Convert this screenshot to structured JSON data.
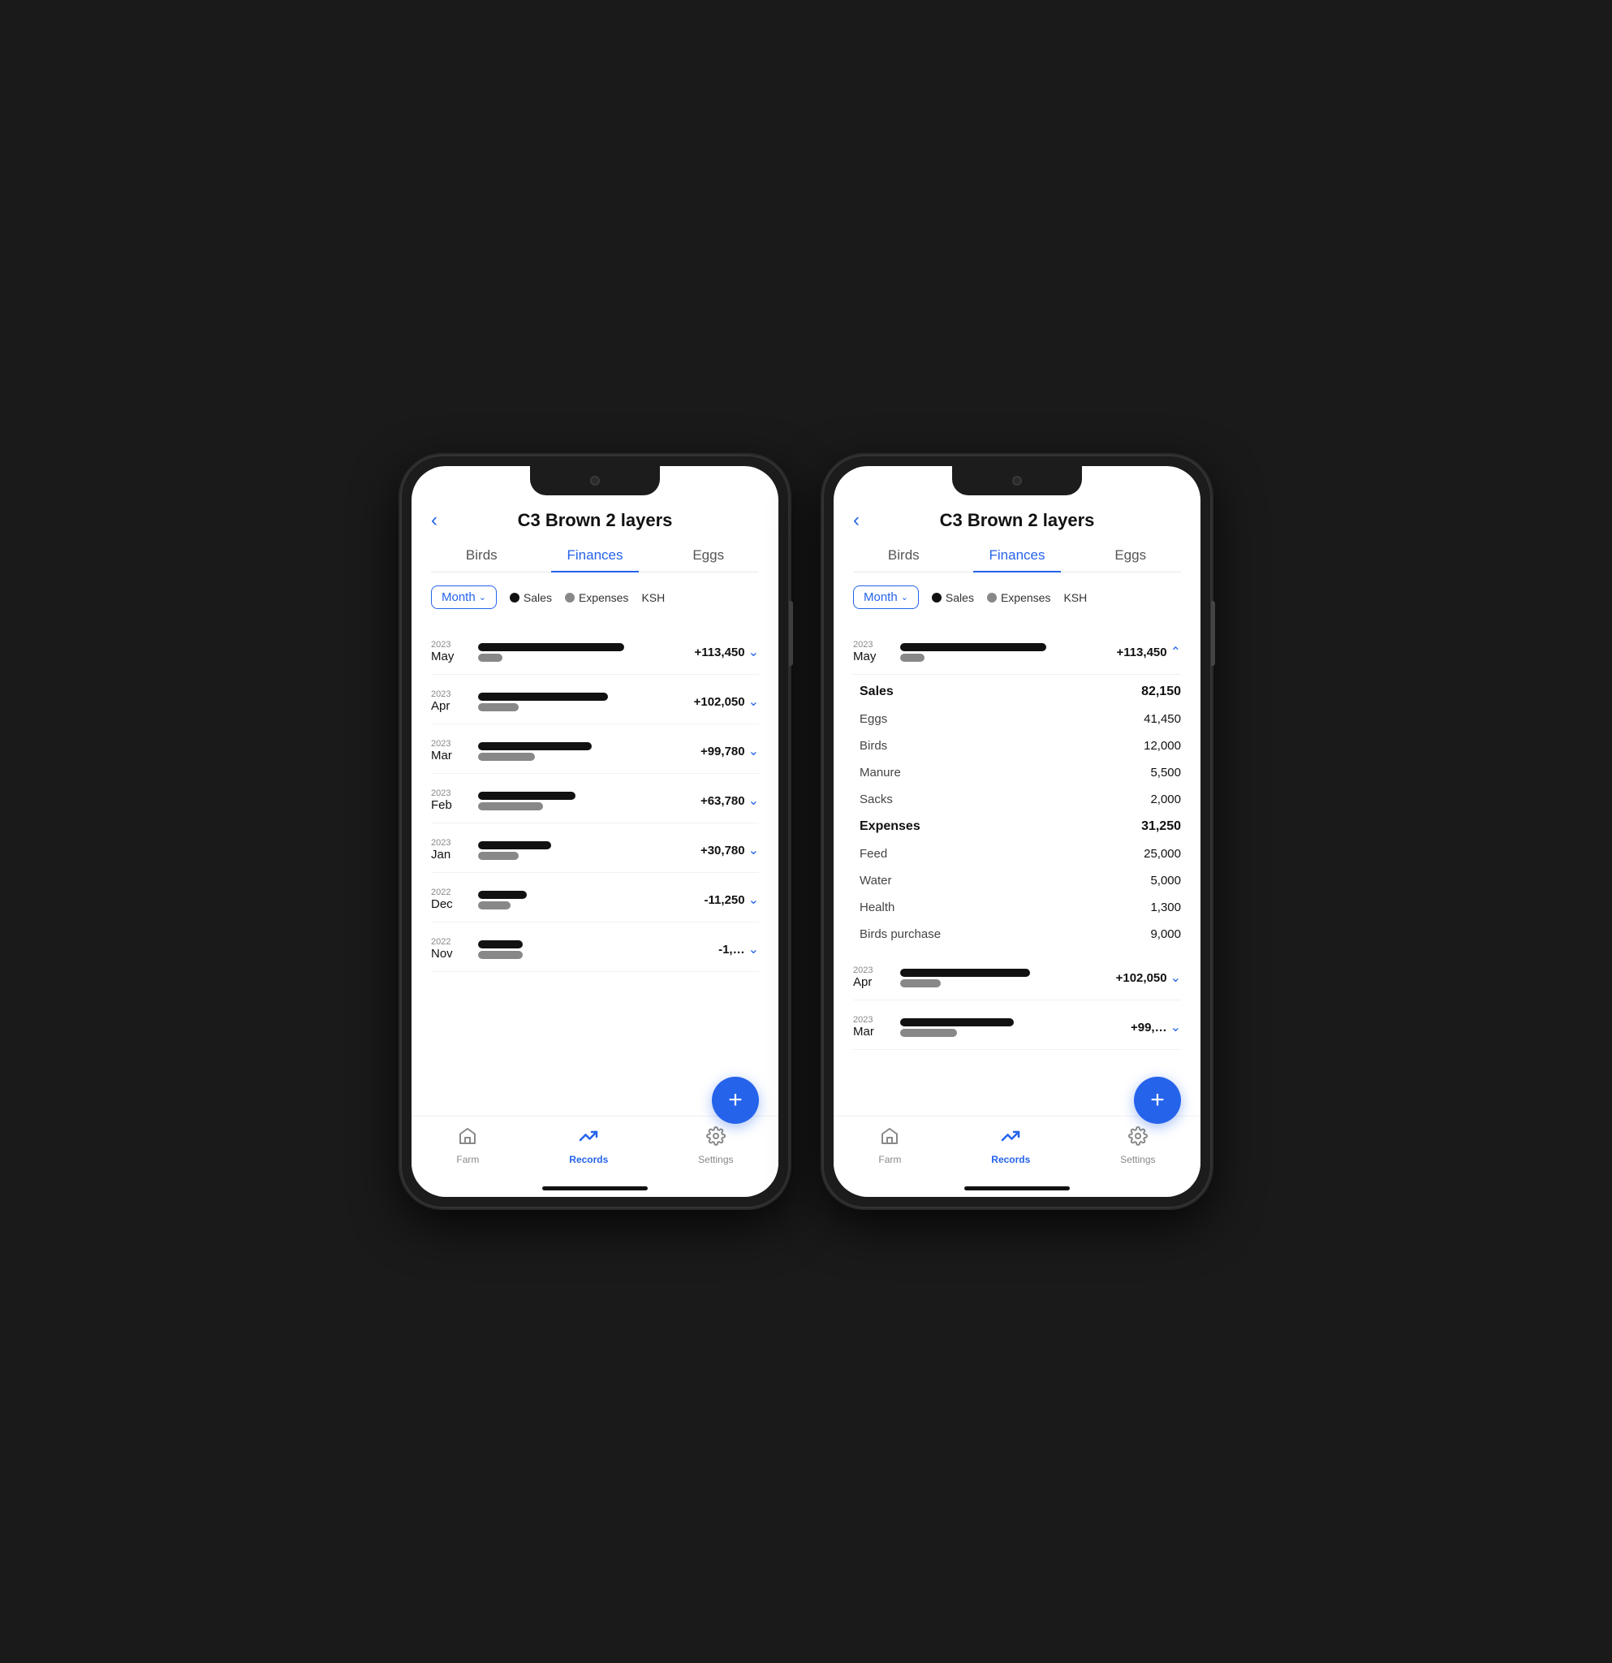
{
  "phones": [
    {
      "id": "phone-left",
      "header": {
        "title": "C3 Brown 2 layers",
        "back_label": "‹"
      },
      "tabs": [
        {
          "id": "birds",
          "label": "Birds",
          "active": false
        },
        {
          "id": "finances",
          "label": "Finances",
          "active": true
        },
        {
          "id": "eggs",
          "label": "Eggs",
          "active": false
        }
      ],
      "filter": {
        "month_label": "Month",
        "chevron": "⌄",
        "legend": [
          {
            "label": "Sales",
            "color": "black"
          },
          {
            "label": "Expenses",
            "color": "gray"
          }
        ],
        "currency": "KSH"
      },
      "months": [
        {
          "year": "2023",
          "month": "May",
          "sales_width": 180,
          "expenses_width": 30,
          "amount": "+113,450",
          "expanded": false
        },
        {
          "year": "2023",
          "month": "Apr",
          "sales_width": 160,
          "expenses_width": 50,
          "amount": "+102,050",
          "expanded": false
        },
        {
          "year": "2023",
          "month": "Mar",
          "sales_width": 140,
          "expenses_width": 70,
          "amount": "+99,780",
          "expanded": false
        },
        {
          "year": "2023",
          "month": "Feb",
          "sales_width": 120,
          "expenses_width": 80,
          "amount": "+63,780",
          "expanded": false
        },
        {
          "year": "2023",
          "month": "Jan",
          "sales_width": 90,
          "expenses_width": 50,
          "amount": "+30,780",
          "expanded": false
        },
        {
          "year": "2022",
          "month": "Dec",
          "sales_width": 60,
          "expenses_width": 40,
          "amount": "-11,250",
          "expanded": false
        },
        {
          "year": "2022",
          "month": "Nov",
          "sales_width": 55,
          "expenses_width": 55,
          "amount": "-1,…",
          "expanded": false
        }
      ],
      "fab_label": "+",
      "nav": [
        {
          "id": "farm",
          "label": "Farm",
          "active": false,
          "icon": "⌂"
        },
        {
          "id": "records",
          "label": "Records",
          "active": true,
          "icon": "↗"
        },
        {
          "id": "settings",
          "label": "Settings",
          "active": false,
          "icon": "⚙"
        }
      ]
    },
    {
      "id": "phone-right",
      "header": {
        "title": "C3 Brown 2 layers",
        "back_label": "‹"
      },
      "tabs": [
        {
          "id": "birds",
          "label": "Birds",
          "active": false
        },
        {
          "id": "finances",
          "label": "Finances",
          "active": true
        },
        {
          "id": "eggs",
          "label": "Eggs",
          "active": false
        }
      ],
      "filter": {
        "month_label": "Month",
        "chevron": "⌄",
        "legend": [
          {
            "label": "Sales",
            "color": "black"
          },
          {
            "label": "Expenses",
            "color": "gray"
          }
        ],
        "currency": "KSH"
      },
      "months": [
        {
          "year": "2023",
          "month": "May",
          "sales_width": 180,
          "expenses_width": 30,
          "amount": "+113,450",
          "expanded": true,
          "details": {
            "sales": {
              "label": "Sales",
              "total": "82,150",
              "items": [
                {
                  "label": "Eggs",
                  "value": "41,450"
                },
                {
                  "label": "Birds",
                  "value": "12,000"
                },
                {
                  "label": "Manure",
                  "value": "5,500"
                },
                {
                  "label": "Sacks",
                  "value": "2,000"
                }
              ]
            },
            "expenses": {
              "label": "Expenses",
              "total": "31,250",
              "items": [
                {
                  "label": "Feed",
                  "value": "25,000"
                },
                {
                  "label": "Water",
                  "value": "5,000"
                },
                {
                  "label": "Health",
                  "value": "1,300"
                },
                {
                  "label": "Birds purchase",
                  "value": "9,000"
                }
              ]
            }
          }
        },
        {
          "year": "2023",
          "month": "Apr",
          "sales_width": 160,
          "expenses_width": 50,
          "amount": "+102,050",
          "expanded": false
        },
        {
          "year": "2023",
          "month": "Mar",
          "sales_width": 140,
          "expenses_width": 70,
          "amount": "+99,…",
          "expanded": false
        }
      ],
      "fab_label": "+",
      "nav": [
        {
          "id": "farm",
          "label": "Farm",
          "active": false,
          "icon": "⌂"
        },
        {
          "id": "records",
          "label": "Records",
          "active": true,
          "icon": "↗"
        },
        {
          "id": "settings",
          "label": "Settings",
          "active": false,
          "icon": "⚙"
        }
      ]
    }
  ]
}
